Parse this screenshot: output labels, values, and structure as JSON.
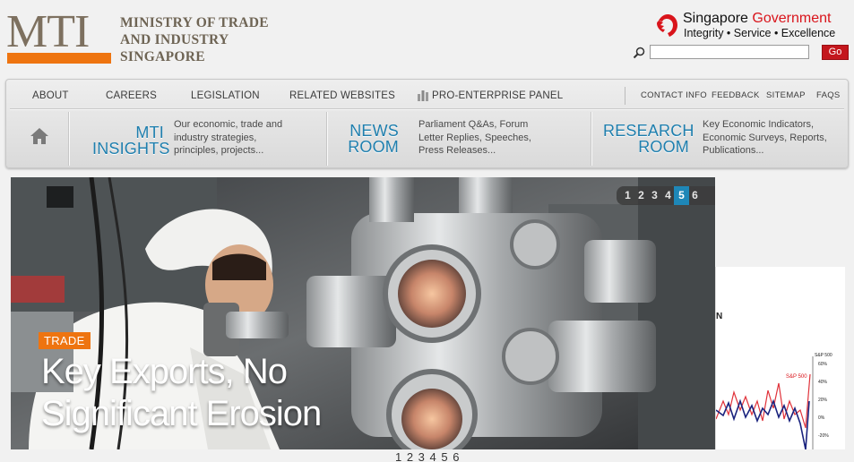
{
  "header": {
    "logo_text": "MTI",
    "ministry_line1": "MINISTRY OF TRADE",
    "ministry_line2": "AND INDUSTRY",
    "ministry_line3": "SINGAPORE",
    "sg_word1": "Singapore",
    "sg_word2": "Government",
    "motto": "Integrity • Service • Excellence",
    "search_value": "",
    "go_label": "Go"
  },
  "nav": {
    "top": [
      "ABOUT",
      "CAREERS",
      "LEGISLATION",
      "RELATED WEBSITES",
      "PRO-ENTERPRISE PANEL"
    ],
    "utility": [
      "CONTACT INFO",
      "FEEDBACK",
      "SITEMAP",
      "FAQS"
    ],
    "sections": [
      {
        "title1": "MTI",
        "title2": "INSIGHTS",
        "desc": "Our economic, trade and industry strategies, principles, projects..."
      },
      {
        "title1": "NEWS",
        "title2": "ROOM",
        "desc": "Parliament Q&As, Forum Letter Replies, Speeches, Press Releases..."
      },
      {
        "title1": "RESEARCH",
        "title2": "ROOM",
        "desc": "Key Economic Indicators, Economic Surveys, Reports, Publications..."
      }
    ]
  },
  "hero": {
    "pages": [
      "1",
      "2",
      "3",
      "4",
      "5",
      "6"
    ],
    "active_page": 5,
    "tag": "TRADE",
    "headline_line1": "Key Exports, No",
    "headline_line2": "Significant Erosion"
  },
  "peek": {
    "label": "N",
    "legend": "S&P 500",
    "axis_title": "S&P 500",
    "ticks": [
      "60%",
      "40%",
      "20%",
      "0%",
      "-20%"
    ]
  },
  "bottom_pager": "1 2 3 4 5 6",
  "colors": {
    "accent_orange": "#ee7410",
    "link_blue": "#1f7fae",
    "go_red": "#c4171d",
    "pager_active": "#1e87b8"
  }
}
